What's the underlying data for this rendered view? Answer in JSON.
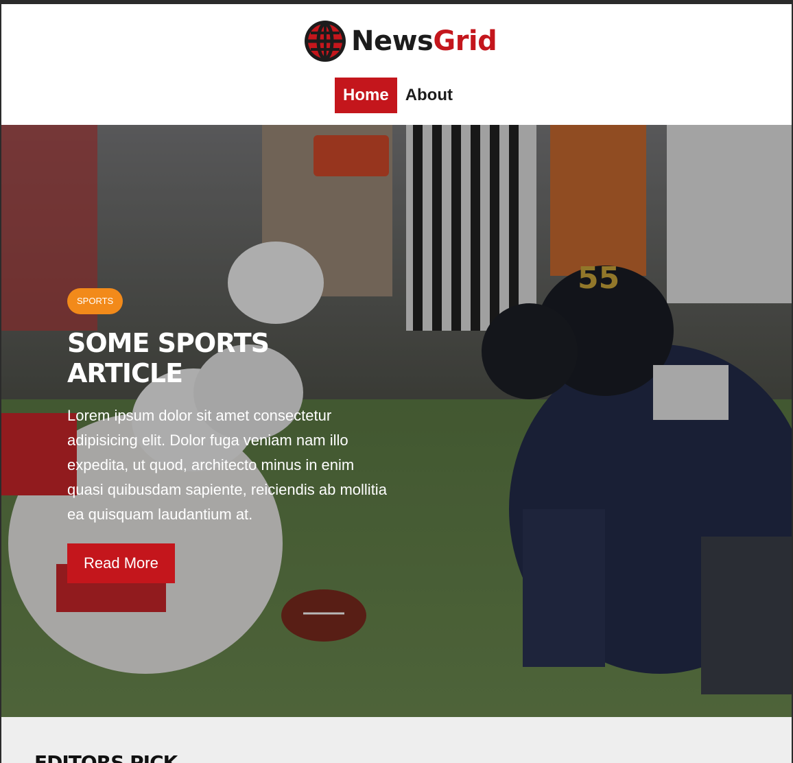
{
  "brand": {
    "name_part1": "News",
    "name_part2": "Grid",
    "accent_color": "#c4161c",
    "logo_icon": "globe-icon"
  },
  "nav": {
    "items": [
      {
        "label": "Home",
        "active": true
      },
      {
        "label": "About",
        "active": false
      }
    ]
  },
  "hero": {
    "category": "SPORTS",
    "category_color": "#f28a1a",
    "title": "Some Sports Article",
    "body": "Lorem ipsum dolor sit amet consectetur adipisicing elit. Dolor fuga veniam nam illo expedita, ut quod, architecto minus in enim quasi quibusdam sapiente, reiciendis ab mollitia ea quisquam laudantium at.",
    "button_label": "Read More",
    "image": "football-line-of-scrimmage-photo"
  },
  "editors_pick": {
    "title": "Editors Pick"
  }
}
